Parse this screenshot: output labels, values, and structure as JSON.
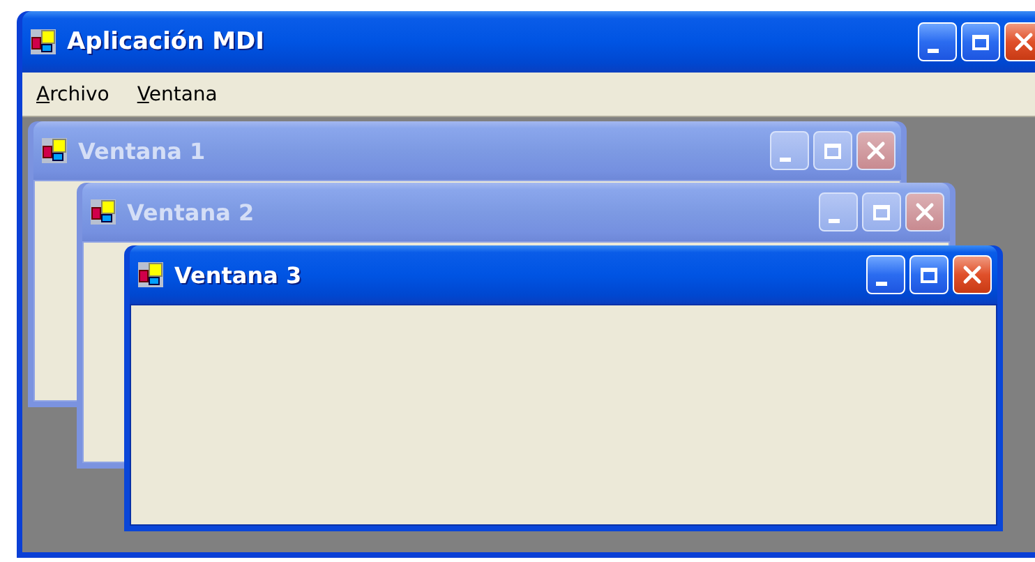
{
  "window": {
    "title": "Aplicación MDI",
    "active": true
  },
  "menu": [
    {
      "label": "Archivo"
    },
    {
      "label": "Ventana"
    }
  ],
  "children": [
    {
      "title": "Ventana 1",
      "active": false
    },
    {
      "title": "Ventana 2",
      "active": false
    },
    {
      "title": "Ventana 3",
      "active": true
    }
  ]
}
